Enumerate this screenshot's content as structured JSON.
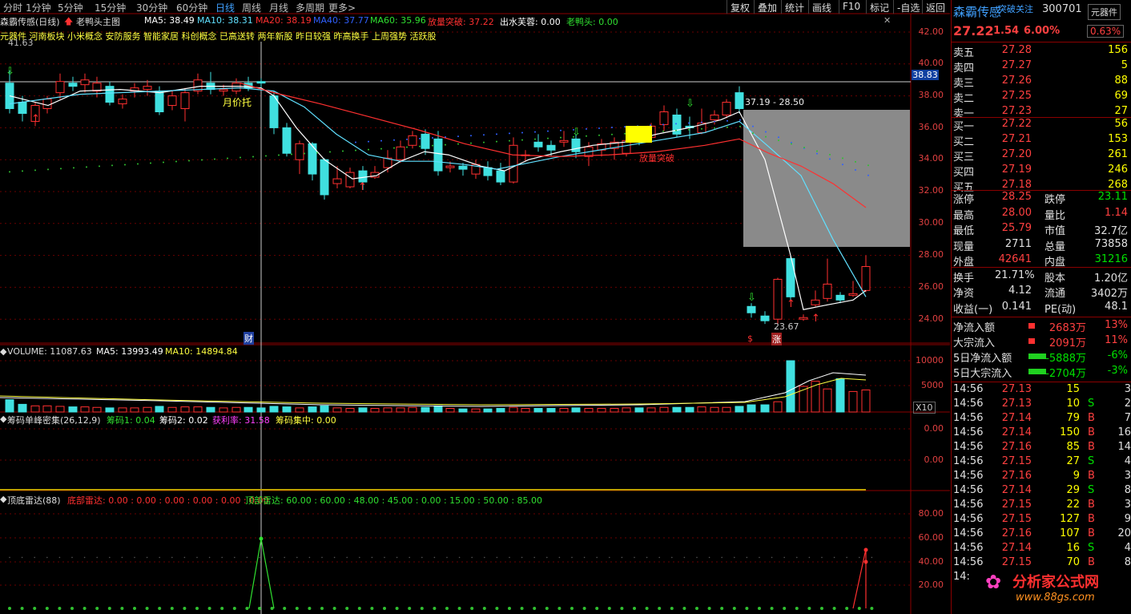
{
  "toolbar": {
    "periods": [
      "分时",
      "1分钟",
      "5分钟",
      "15分钟",
      "30分钟",
      "60分钟",
      "日线",
      "周线",
      "月线",
      "多周期",
      "更多>"
    ],
    "active_period": "日线",
    "right_buttons": [
      "复权",
      "叠加",
      "统计",
      "画线",
      "F10",
      "标记",
      "-自选",
      "返回"
    ]
  },
  "main_info": {
    "name": "森霸传感(日线)",
    "indicator": "老鸭头主图",
    "ma5": "MA5: 38.49",
    "ma10": "MA10: 38.31",
    "ma20": "MA20: 38.19",
    "ma40": "MA40: 37.77",
    "ma60": "MA60: 35.96",
    "breakout": "放量突破: 37.22",
    "chushui": "出水芙蓉: 0.00",
    "laoyatou": "老鸭头: 0.00"
  },
  "concepts": "元器件 河南板块 小米概念 安防服务 智能家居 科创概念 已高送转 两年新股 昨日较强 昨高换手 上周强势 活跃股",
  "annotations": {
    "high_mark": "41.63",
    "month_support": "月价托",
    "breakout_label": "放量突破",
    "range_label": "37.19 - 28.50",
    "low_mark": "23.67",
    "cai": "财",
    "zhang": "涨",
    "dollar": "$",
    "cursor_price": "38.83",
    "x10": "X10"
  },
  "y_axis_main": [
    "42.00",
    "40.00",
    "38.00",
    "36.00",
    "34.00",
    "32.00",
    "30.00",
    "28.00",
    "26.00",
    "24.00"
  ],
  "volume_info": {
    "title": "VOLUME: 11087.63",
    "ma5": "MA5: 13993.49",
    "ma10": "MA10: 14894.84"
  },
  "y_axis_volume": [
    "10000",
    "5000"
  ],
  "chip_info": {
    "title": "筹码单峰密集(26,12,9)",
    "c1": "筹码1: 0.04",
    "c2": "筹码2: 0.02",
    "profit": "获利率: 31.58",
    "focus": "筹码集中: 0.00"
  },
  "y_axis_chip": [
    "0.00",
    "0.00"
  ],
  "radar_info": {
    "title": "顶底雷达(88)",
    "bottom": "底部雷达: 0.00 : 0.00 : 0.00 : 0.00 : 0.00 : 0.00",
    "top": "顶部雷达: 60.00 : 60.00 : 48.00 : 45.00 : 0.00 : 15.00 : 50.00 : 85.00"
  },
  "y_axis_radar": [
    "80.00",
    "60.00",
    "40.00",
    "20.00"
  ],
  "quote": {
    "name": "森霸传感",
    "follow": "突破关注",
    "code": "300701",
    "sector": "元器件",
    "price": "27.22",
    "change": "1.54",
    "pct": "6.00%",
    "sector_pct": "0.63%",
    "asks": [
      [
        "卖五",
        "27.28",
        "156"
      ],
      [
        "卖四",
        "27.27",
        "5"
      ],
      [
        "卖三",
        "27.26",
        "88"
      ],
      [
        "卖二",
        "27.25",
        "69"
      ],
      [
        "卖一",
        "27.23",
        "27"
      ]
    ],
    "bids": [
      [
        "买一",
        "27.22",
        "56"
      ],
      [
        "买二",
        "27.21",
        "153"
      ],
      [
        "买三",
        "27.20",
        "261"
      ],
      [
        "买四",
        "27.19",
        "246"
      ],
      [
        "买五",
        "27.18",
        "268"
      ]
    ],
    "stats": [
      [
        "涨停",
        "28.25",
        "跌停",
        "23.11"
      ],
      [
        "最高",
        "28.00",
        "量比",
        "1.14"
      ],
      [
        "最低",
        "25.79",
        "市值",
        "32.7亿"
      ],
      [
        "现量",
        "2711",
        "总量",
        "73858"
      ],
      [
        "外盘",
        "42641",
        "内盘",
        "31216"
      ],
      [
        "换手",
        "21.71%",
        "股本",
        "1.20亿"
      ],
      [
        "净资",
        "4.12",
        "流通",
        "3402万"
      ],
      [
        "收益(一)",
        "0.141",
        "PE(动)",
        "48.1"
      ]
    ],
    "flows": [
      [
        "净流入额",
        "2683万",
        "13%"
      ],
      [
        "大宗流入",
        "2091万",
        "11%"
      ],
      [
        "5日净流入额",
        "-5888万",
        "-6%"
      ],
      [
        "5日大宗流入",
        "-2704万",
        "-3%"
      ]
    ],
    "ticks": [
      [
        "14:56",
        "27.13",
        "15",
        "",
        "3"
      ],
      [
        "14:56",
        "27.13",
        "10",
        "S",
        "2"
      ],
      [
        "14:56",
        "27.14",
        "79",
        "B",
        "7"
      ],
      [
        "14:56",
        "27.14",
        "150",
        "B",
        "16"
      ],
      [
        "14:56",
        "27.16",
        "85",
        "B",
        "14"
      ],
      [
        "14:56",
        "27.15",
        "27",
        "S",
        "4"
      ],
      [
        "14:56",
        "27.16",
        "9",
        "B",
        "3"
      ],
      [
        "14:56",
        "27.14",
        "29",
        "S",
        "8"
      ],
      [
        "14:56",
        "27.15",
        "22",
        "B",
        "3"
      ],
      [
        "14:56",
        "27.15",
        "127",
        "B",
        "9"
      ],
      [
        "14:56",
        "27.16",
        "107",
        "B",
        "20"
      ],
      [
        "14:56",
        "27.14",
        "16",
        "S",
        "4"
      ],
      [
        "14:56",
        "27.15",
        "70",
        "B",
        "8"
      ],
      [
        "14:",
        "",
        "",
        "",
        ""
      ]
    ],
    "watermark": "分析家公式网",
    "watermark_url": "www.88gs.com"
  }
}
